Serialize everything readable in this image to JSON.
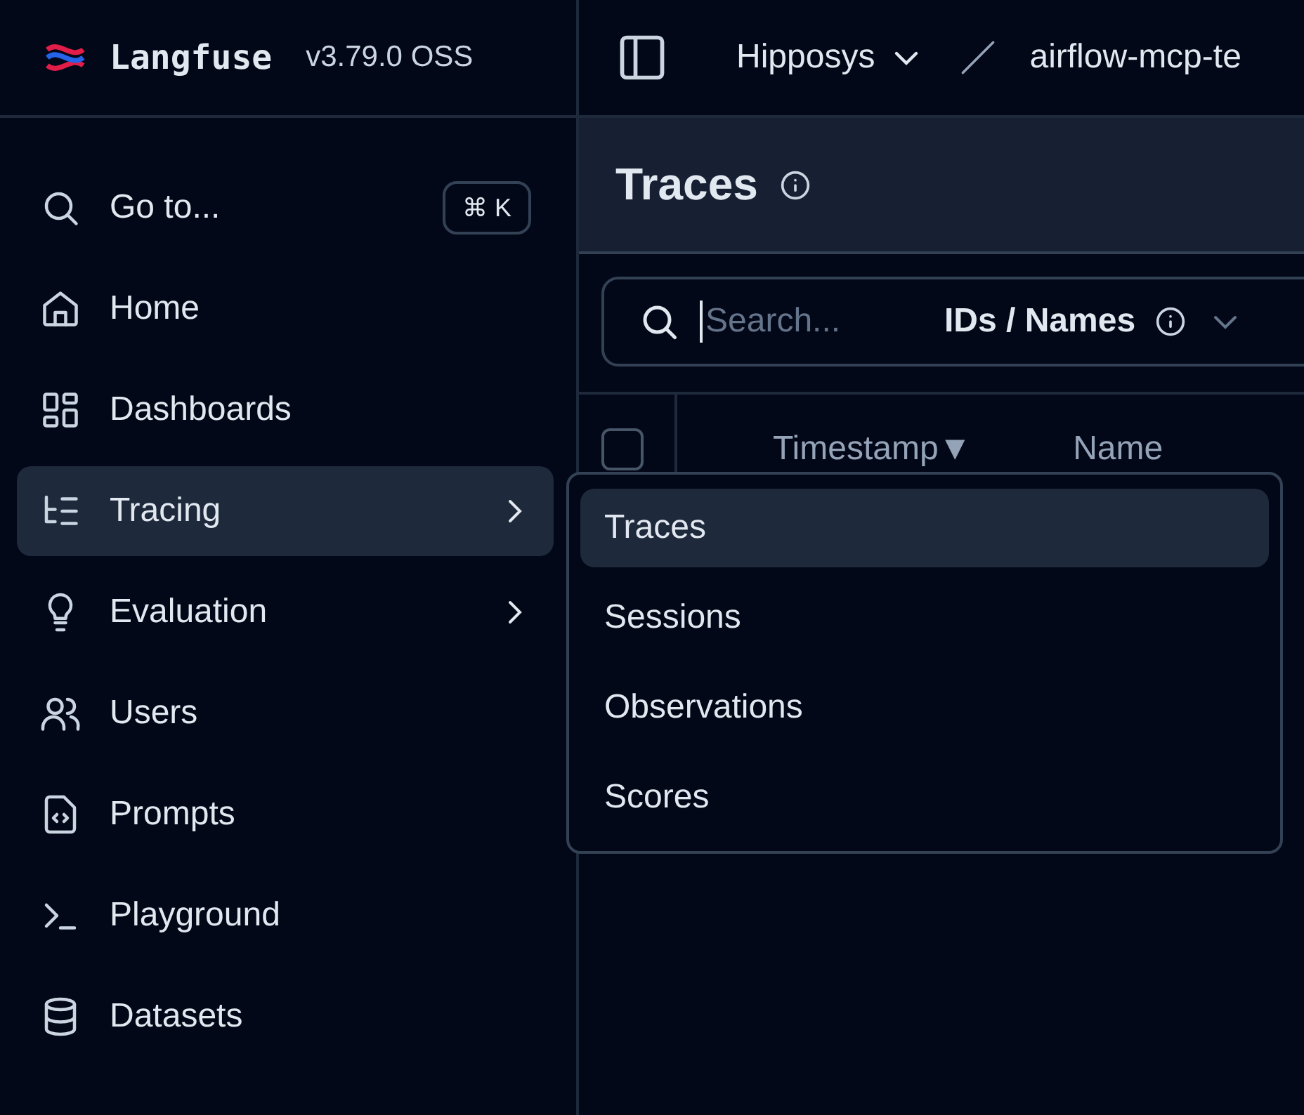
{
  "brand": {
    "name": "Langfuse",
    "version": "v3.79.0 OSS"
  },
  "breadcrumb": {
    "organization": "Hipposys",
    "project": "airflow-mcp-te"
  },
  "sidebar": {
    "items": [
      {
        "label": "Go to...",
        "shortcut": "⌘ K",
        "selected": false,
        "has_submenu": false
      },
      {
        "label": "Home",
        "selected": false,
        "has_submenu": false
      },
      {
        "label": "Dashboards",
        "selected": false,
        "has_submenu": false
      },
      {
        "label": "Tracing",
        "selected": true,
        "has_submenu": true
      },
      {
        "label": "Evaluation",
        "selected": false,
        "has_submenu": true
      },
      {
        "label": "Users",
        "selected": false,
        "has_submenu": false
      },
      {
        "label": "Prompts",
        "selected": false,
        "has_submenu": false
      },
      {
        "label": "Playground",
        "selected": false,
        "has_submenu": false
      },
      {
        "label": "Datasets",
        "selected": false,
        "has_submenu": false
      }
    ]
  },
  "page": {
    "title": "Traces"
  },
  "search": {
    "placeholder": "Search...",
    "mode": "IDs / Names"
  },
  "table": {
    "select_all_checked": false,
    "columns": [
      {
        "label": "Timestamp",
        "sort_mark": "▼"
      },
      {
        "label": "Name"
      }
    ]
  },
  "submenu": {
    "items": [
      {
        "label": "Traces",
        "selected": true
      },
      {
        "label": "Sessions",
        "selected": false
      },
      {
        "label": "Observations",
        "selected": false
      },
      {
        "label": "Scores",
        "selected": false
      }
    ]
  }
}
